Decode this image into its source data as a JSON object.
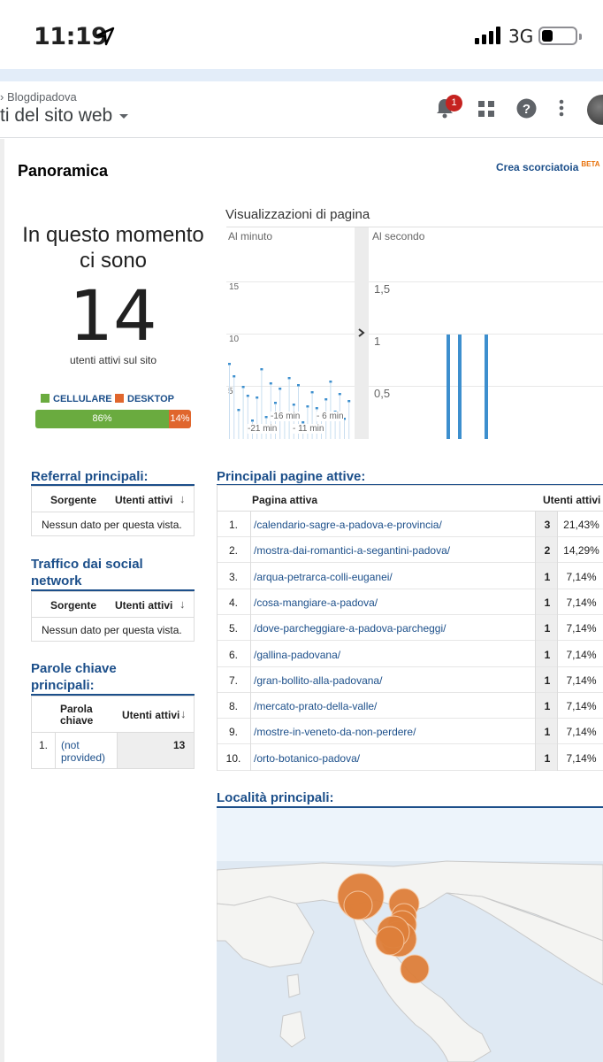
{
  "status_bar": {
    "time": "11:19",
    "network": "3G"
  },
  "ga_header": {
    "breadcrumb": "Blogdipadova",
    "view_title": "ti del sito web",
    "notification_count": "1"
  },
  "overview": {
    "title": "Panoramica",
    "shortcut_label": "Crea scorciatoia",
    "shortcut_badge": "BETA"
  },
  "realtime": {
    "title_line1": "In questo momento",
    "title_line2": "ci sono",
    "count": "14",
    "subtitle": "utenti attivi sul sito",
    "legend": [
      {
        "label": "CELLULARE",
        "color": "#6aab3f"
      },
      {
        "label": "DESKTOP",
        "color": "#e0662d"
      }
    ],
    "split": [
      {
        "label": "86%",
        "share": 0.86,
        "color": "#6aab3f"
      },
      {
        "label": "14%",
        "share": 0.14,
        "color": "#e0662d"
      }
    ]
  },
  "pageviews_chart": {
    "title": "Visualizzazioni di pagina",
    "per_minute_label": "Al minuto",
    "per_second_label": "Al secondo",
    "minute_ticks_y": [
      "15",
      "10",
      "5"
    ],
    "minute_ticks_x": [
      "-16 min",
      "- 6 min",
      "-21 min",
      "- 11 min"
    ],
    "second_ticks_y": [
      "1,5",
      "1",
      "0,5"
    ],
    "per_second_spikes_seconds": [
      13,
      12,
      8
    ]
  },
  "referrals": {
    "title": "Referral principali:",
    "col_source": "Sorgente",
    "col_users": "Utenti attivi",
    "empty": "Nessun dato per questa vista."
  },
  "social": {
    "title_line1": "Traffico dai social",
    "title_line2": "network",
    "col_source": "Sorgente",
    "col_users": "Utenti attivi",
    "empty": "Nessun dato per questa vista."
  },
  "keywords": {
    "title_line1": "Parole chiave",
    "title_line2": "principali:",
    "col_kw_line1": "Parola",
    "col_kw_line2": "chiave",
    "col_users": "Utenti attivi",
    "rows": [
      {
        "n": "1.",
        "kw_line1": "(not",
        "kw_line2": "provided)",
        "users": "13"
      }
    ]
  },
  "active_pages": {
    "title": "Principali pagine attive:",
    "col_page": "Pagina attiva",
    "col_users": "Utenti attivi",
    "rows": [
      {
        "n": "1.",
        "page": "/calendario-sagre-a-padova-e-provincia/",
        "count": "3",
        "pct": "21,43%"
      },
      {
        "n": "2.",
        "page": "/mostra-dai-romantici-a-segantini-padova/",
        "count": "2",
        "pct": "14,29%"
      },
      {
        "n": "3.",
        "page": "/arqua-petrarca-colli-euganei/",
        "count": "1",
        "pct": "7,14%"
      },
      {
        "n": "4.",
        "page": "/cosa-mangiare-a-padova/",
        "count": "1",
        "pct": "7,14%"
      },
      {
        "n": "5.",
        "page": "/dove-parcheggiare-a-padova-parcheggi/",
        "count": "1",
        "pct": "7,14%"
      },
      {
        "n": "6.",
        "page": "/gallina-padovana/",
        "count": "1",
        "pct": "7,14%"
      },
      {
        "n": "7.",
        "page": "/gran-bollito-alla-padovana/",
        "count": "1",
        "pct": "7,14%"
      },
      {
        "n": "8.",
        "page": "/mercato-prato-della-valle/",
        "count": "1",
        "pct": "7,14%"
      },
      {
        "n": "9.",
        "page": "/mostre-in-veneto-da-non-perdere/",
        "count": "1",
        "pct": "7,14%"
      },
      {
        "n": "10.",
        "page": "/orto-botanico-padova/",
        "count": "1",
        "pct": "7,14%"
      }
    ]
  },
  "locations": {
    "title": "Località principali:"
  },
  "colors": {
    "accent": "#1c4f8a",
    "bar_blue": "#3d8fce",
    "map_marker": "#de7f3a"
  }
}
